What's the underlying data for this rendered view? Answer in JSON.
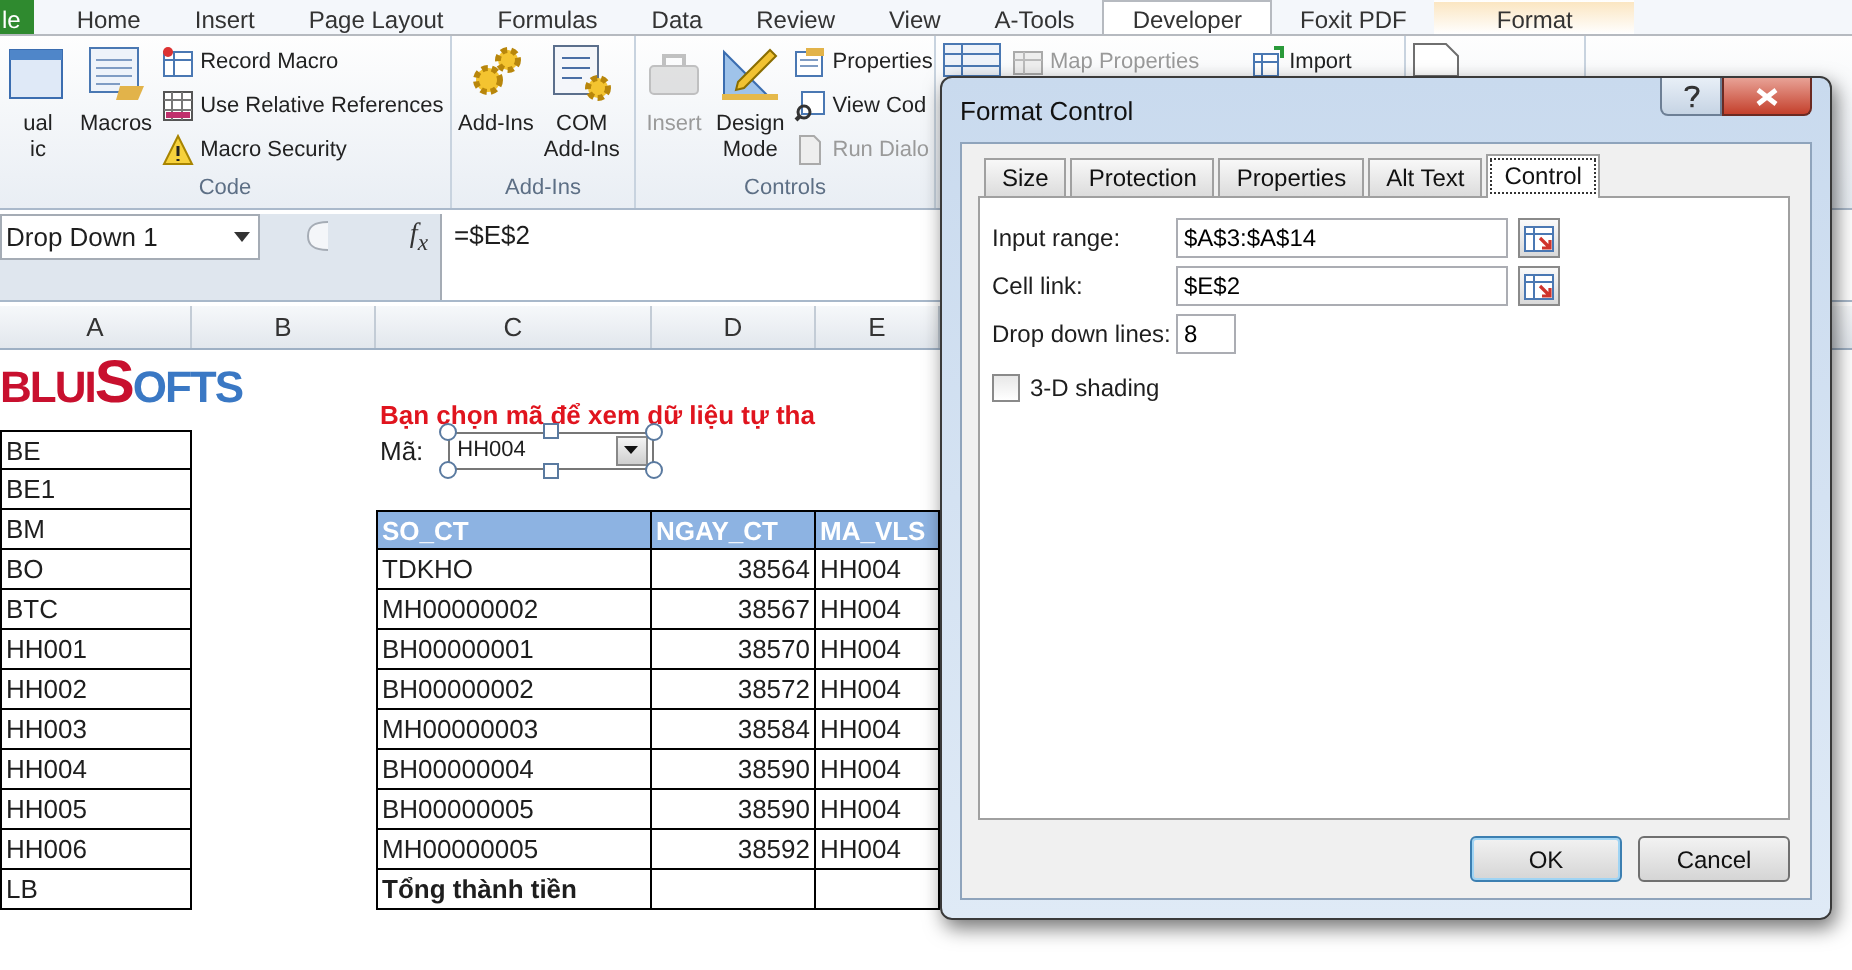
{
  "ribbon": {
    "tabs": [
      {
        "label": "le",
        "kind": "file",
        "selected": false
      },
      {
        "label": "Home",
        "kind": "normal",
        "selected": false
      },
      {
        "label": "Insert",
        "kind": "normal",
        "selected": false
      },
      {
        "label": "Page Layout",
        "kind": "normal",
        "selected": false
      },
      {
        "label": "Formulas",
        "kind": "normal",
        "selected": false
      },
      {
        "label": "Data",
        "kind": "normal",
        "selected": false
      },
      {
        "label": "Review",
        "kind": "normal",
        "selected": false
      },
      {
        "label": "View",
        "kind": "normal",
        "selected": false
      },
      {
        "label": "A-Tools",
        "kind": "normal",
        "selected": false
      },
      {
        "label": "Developer",
        "kind": "normal",
        "selected": true
      },
      {
        "label": "Foxit PDF",
        "kind": "normal",
        "selected": false
      },
      {
        "label": "Format",
        "kind": "contextual",
        "selected": false
      }
    ],
    "groups": [
      {
        "label": "Code",
        "large": [
          {
            "lines": [
              "ual",
              "ic"
            ],
            "disabled": false
          },
          {
            "lines": [
              "Macros"
            ],
            "disabled": false
          }
        ],
        "small": [
          [
            {
              "label": "Record Macro",
              "disabled": false
            },
            {
              "label": "Use Relative References",
              "disabled": false
            },
            {
              "label": "Macro Security",
              "disabled": false
            }
          ]
        ]
      },
      {
        "label": "Add-Ins",
        "large": [
          {
            "lines": [
              "Add-Ins"
            ],
            "disabled": false
          },
          {
            "lines": [
              "COM",
              "Add-Ins"
            ],
            "disabled": false
          }
        ]
      },
      {
        "label": "Controls",
        "large": [
          {
            "lines": [
              "Insert"
            ],
            "disabled": true
          },
          {
            "lines": [
              "Design",
              "Mode"
            ],
            "disabled": false
          }
        ],
        "small": [
          [
            {
              "label": "Properties",
              "disabled": false
            },
            {
              "label": "View Cod",
              "disabled": false
            },
            {
              "label": "Run Dialo",
              "disabled": true
            }
          ]
        ]
      },
      {
        "large": [
          {
            "disabled": false
          }
        ],
        "small": [
          [
            {
              "label": "Map Properties",
              "disabled": true
            }
          ],
          [
            {
              "label": "Import",
              "disabled": false
            }
          ]
        ]
      },
      {
        "large": [
          {
            "disabled": false
          }
        ]
      }
    ]
  },
  "formula_bar": {
    "name_box": "Drop Down 1",
    "function_label": "f$_{x}$",
    "formula": "=$E$2"
  },
  "sheet": {
    "columns": [
      "A",
      "B",
      "C",
      "D",
      "E"
    ],
    "logo": [
      "BLUI",
      "S",
      "OFTS"
    ],
    "instruction": "Bạn chọn mã để xem dữ liệu tự tha",
    "dropdown": {
      "label": "Mã:",
      "value": "HH004"
    },
    "code_list": [
      "BE",
      "BE1",
      "BM",
      "BO",
      "BTC",
      "HH001",
      "HH002",
      "HH003",
      "HH004",
      "HH005",
      "HH006",
      "LB"
    ],
    "table": {
      "columns": [
        "SO_CT",
        "NGAY_CT",
        "MA_VLS"
      ],
      "rows": [
        [
          "TDKHO",
          "38564",
          "HH004"
        ],
        [
          "MH00000002",
          "38567",
          "HH004"
        ],
        [
          "BH00000001",
          "38570",
          "HH004"
        ],
        [
          "BH00000002",
          "38572",
          "HH004"
        ],
        [
          "MH00000003",
          "38584",
          "HH004"
        ],
        [
          "BH00000004",
          "38590",
          "HH004"
        ],
        [
          "BH00000005",
          "38590",
          "HH004"
        ],
        [
          "MH00000005",
          "38592",
          "HH004"
        ]
      ],
      "total_label": "Tổng thành tiền"
    }
  },
  "dialog": {
    "title": "Format Control",
    "tabs": [
      {
        "label": "Size",
        "selected": false
      },
      {
        "label": "Protection",
        "selected": false
      },
      {
        "label": "Properties",
        "selected": false
      },
      {
        "label": "Alt Text",
        "selected": false
      },
      {
        "label": "Control",
        "selected": true
      }
    ],
    "fields": [
      {
        "label": "Input range:",
        "value": "$A$3:$A$14",
        "kind": "range"
      },
      {
        "label": "Cell link:",
        "value": "$E$2",
        "kind": "range"
      },
      {
        "label": "Drop down lines:",
        "value": "8",
        "kind": "number"
      }
    ],
    "checkbox": {
      "label": "3-D shading",
      "checked": false
    },
    "buttons": [
      {
        "label": "OK",
        "default": true
      },
      {
        "label": "Cancel",
        "default": false
      }
    ]
  }
}
